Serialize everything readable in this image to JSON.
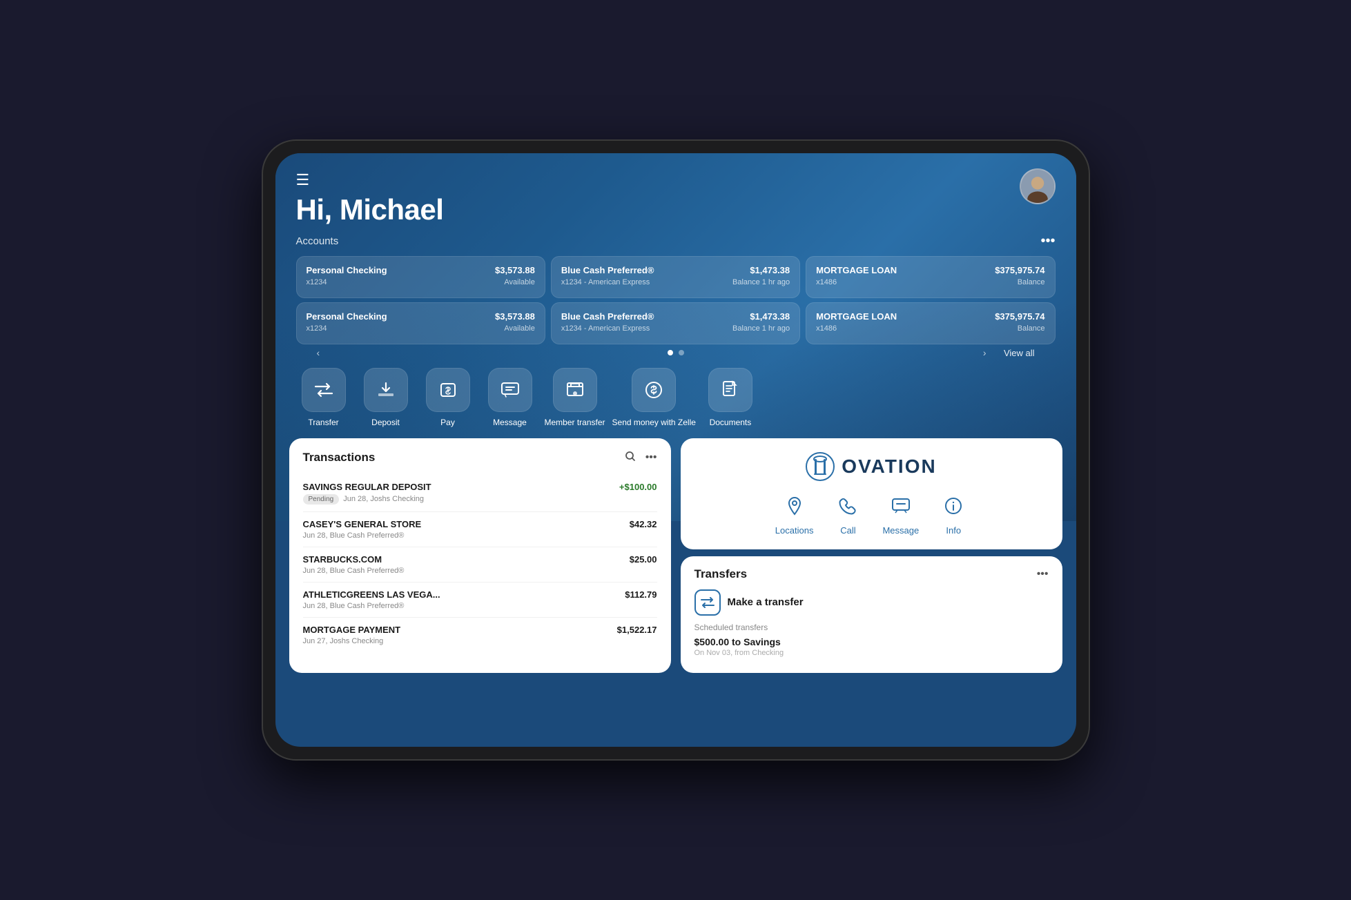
{
  "app": {
    "greeting": "Hi, Michael",
    "menu_icon": "☰"
  },
  "accounts": {
    "label": "Accounts",
    "more_label": "•••",
    "view_all": "View all",
    "row1": [
      {
        "name": "Personal Checking",
        "number": "x1234",
        "amount": "$3,573.88",
        "status": "Available"
      },
      {
        "name": "Blue Cash Preferred®",
        "number": "x1234 - American Express",
        "amount": "$1,473.38",
        "status": "Balance 1 hr ago"
      },
      {
        "name": "MORTGAGE LOAN",
        "number": "x1486",
        "amount": "$375,975.74",
        "status": "Balance"
      }
    ],
    "row2": [
      {
        "name": "Personal Checking",
        "number": "x1234",
        "amount": "$3,573.88",
        "status": "Available"
      },
      {
        "name": "Blue Cash Preferred®",
        "number": "x1234 - American Express",
        "amount": "$1,473.38",
        "status": "Balance 1 hr ago"
      },
      {
        "name": "MORTGAGE LOAN",
        "number": "x1486",
        "amount": "$375,975.74",
        "status": "Balance"
      }
    ]
  },
  "quick_actions": [
    {
      "id": "transfer",
      "label": "Transfer",
      "icon": "⇄"
    },
    {
      "id": "deposit",
      "label": "Deposit",
      "icon": "↧"
    },
    {
      "id": "pay",
      "label": "Pay",
      "icon": "💲"
    },
    {
      "id": "message",
      "label": "Message",
      "icon": "✉"
    },
    {
      "id": "member_transfer",
      "label": "Member transfer",
      "icon": "🏛"
    },
    {
      "id": "zelle",
      "label": "Send money with Zelle",
      "icon": "$"
    },
    {
      "id": "documents",
      "label": "Documents",
      "icon": "📄"
    }
  ],
  "transactions": {
    "title": "Transactions",
    "items": [
      {
        "name": "SAVINGS REGULAR DEPOSIT",
        "amount": "+$100.00",
        "positive": true,
        "pending": true,
        "pending_label": "Pending",
        "meta": "Jun 28, Joshs Checking"
      },
      {
        "name": "CASEY'S GENERAL STORE",
        "amount": "$42.32",
        "positive": false,
        "pending": false,
        "meta": "Jun 28, Blue Cash Preferred®"
      },
      {
        "name": "STARBUCKS.COM",
        "amount": "$25.00",
        "positive": false,
        "pending": false,
        "meta": "Jun 28, Blue Cash Preferred®"
      },
      {
        "name": "ATHLETICGREENS LAS VEGA...",
        "amount": "$112.79",
        "positive": false,
        "pending": false,
        "meta": "Jun 28, Blue Cash Preferred®"
      },
      {
        "name": "MORTGAGE PAYMENT",
        "amount": "$1,522.17",
        "positive": false,
        "pending": false,
        "meta": "Jun 27, Joshs Checking"
      }
    ]
  },
  "ovation": {
    "brand_name": "OVATION",
    "actions": [
      {
        "id": "locations",
        "label": "Locations"
      },
      {
        "id": "call",
        "label": "Call"
      },
      {
        "id": "message",
        "label": "Message"
      },
      {
        "id": "info",
        "label": "Info"
      }
    ]
  },
  "transfers": {
    "title": "Transfers",
    "more_label": "•••",
    "make_transfer_label": "Make a transfer",
    "scheduled_label": "Scheduled transfers",
    "scheduled_item": "$500.00 to Savings",
    "scheduled_sub": "On Nov 03, from Checking"
  }
}
